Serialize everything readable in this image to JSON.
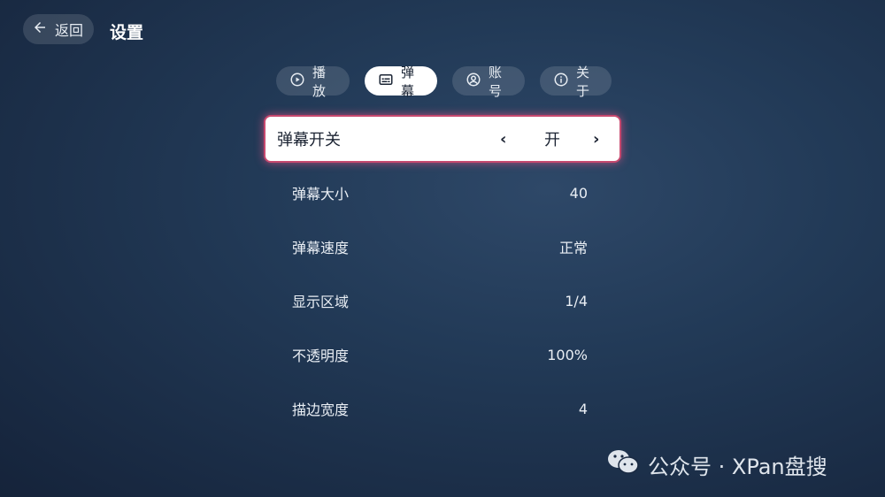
{
  "header": {
    "back_label": "返回",
    "title": "设置"
  },
  "tabs": [
    {
      "label": "播放",
      "icon": "play-circle-icon",
      "active": false
    },
    {
      "label": "弹幕",
      "icon": "subtitles-icon",
      "active": true
    },
    {
      "label": "账号",
      "icon": "account-circle-icon",
      "active": false
    },
    {
      "label": "关于",
      "icon": "info-icon",
      "active": false
    }
  ],
  "settings": {
    "focused": {
      "label": "弹幕开关",
      "value": "开",
      "left_arrow": "‹",
      "right_arrow": "›"
    },
    "rows": [
      {
        "label": "弹幕大小",
        "value": "40"
      },
      {
        "label": "弹幕速度",
        "value": "正常"
      },
      {
        "label": "显示区域",
        "value": "1/4"
      },
      {
        "label": "不透明度",
        "value": "100%"
      },
      {
        "label": "描边宽度",
        "value": "4"
      }
    ]
  },
  "watermark": {
    "text": "公众号 · XPan盘搜",
    "icon": "wechat-icon"
  },
  "colors": {
    "accent_focus_border": "#c7496f",
    "active_tab_bg": "#ffffff"
  }
}
